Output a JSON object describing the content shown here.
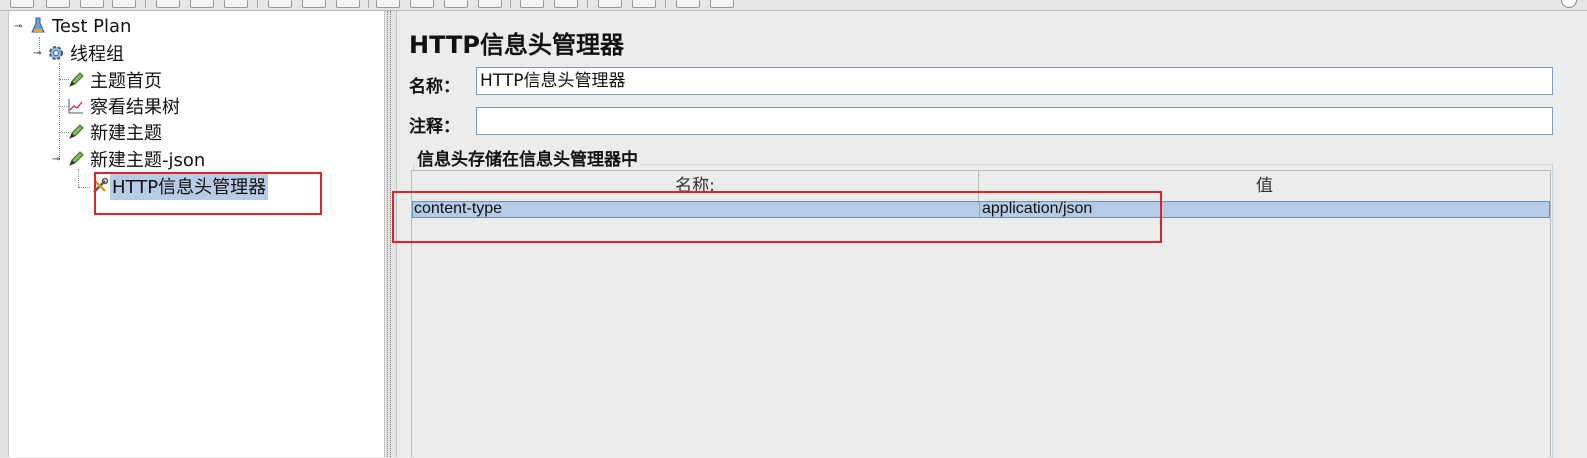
{
  "tree": {
    "nodes": [
      {
        "label": "Test Plan",
        "icon": "test-plan-flask-icon"
      },
      {
        "label": "线程组",
        "icon": "gear-icon"
      },
      {
        "label": "主题首页",
        "icon": "pencil-icon"
      },
      {
        "label": "察看结果树",
        "icon": "chart-icon"
      },
      {
        "label": "新建主题",
        "icon": "pencil-icon"
      },
      {
        "label": "新建主题-json",
        "icon": "pencil-icon"
      },
      {
        "label": "HTTP信息头管理器",
        "icon": "wrench-screwdriver-icon",
        "selected": true
      }
    ]
  },
  "editor": {
    "title": "HTTP信息头管理器",
    "name_label": "名称：",
    "name_value": "HTTP信息头管理器",
    "comment_label": "注释：",
    "comment_value": "",
    "group_title": "信息头存储在信息头管理器中",
    "table": {
      "columns": [
        "名称:",
        "值"
      ],
      "rows": [
        {
          "name": "content-type",
          "value": "application/json",
          "selected": true
        }
      ]
    }
  },
  "colors": {
    "selection": "#b6cbe6",
    "annotation_red": "#e1222a"
  }
}
